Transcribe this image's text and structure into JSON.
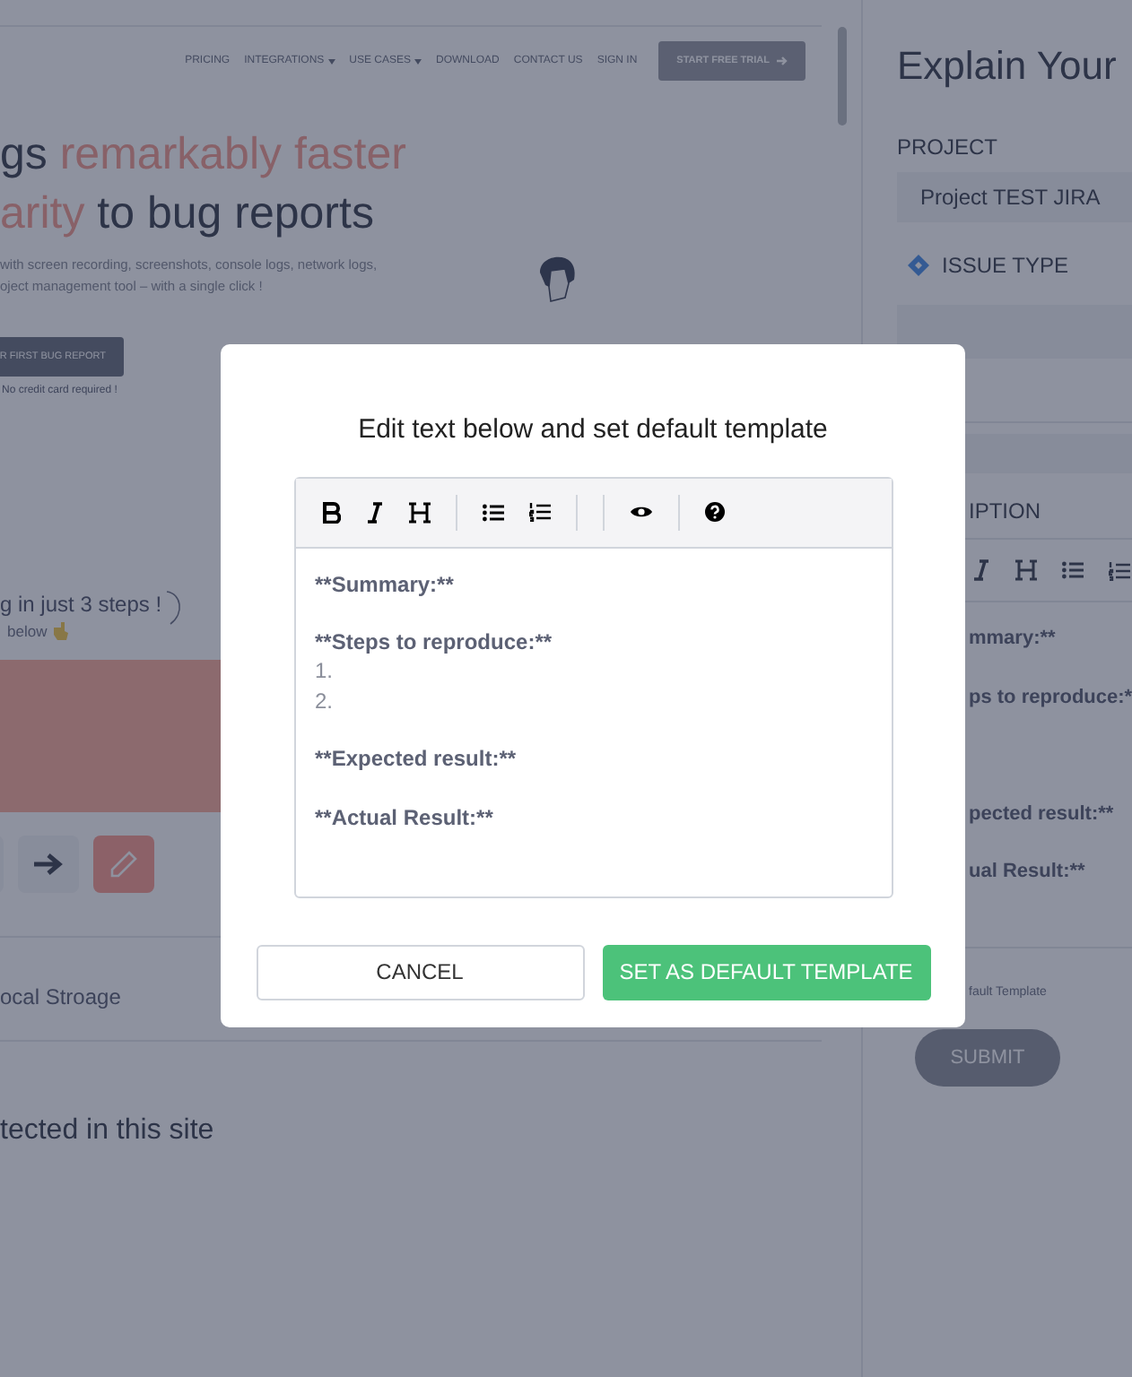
{
  "nav": {
    "items": [
      {
        "label": "PRICING",
        "dropdown": false
      },
      {
        "label": "INTEGRATIONS",
        "dropdown": true
      },
      {
        "label": "USE CASES",
        "dropdown": true
      },
      {
        "label": "DOWNLOAD",
        "dropdown": false
      },
      {
        "label": "CONTACT US",
        "dropdown": false
      },
      {
        "label": "SIGN IN",
        "dropdown": false
      }
    ],
    "cta": "START FREE TRIAL"
  },
  "hero": {
    "headline": [
      [
        {
          "text": "gs ",
          "accent": false
        },
        {
          "text": "remarkably faster",
          "accent": true
        }
      ],
      [
        {
          "text": "arity",
          "accent": true
        },
        {
          "text": " to bug reports",
          "accent": false
        }
      ]
    ],
    "subtitle": [
      "with screen recording, screenshots, console logs, network logs,",
      "oject management tool – with a single click !"
    ],
    "button": "R FIRST BUG REPORT",
    "note": "No credit card required !"
  },
  "steps": {
    "title": "g in just 3 steps !",
    "hint": "below"
  },
  "tools": [
    {
      "kind": "arrow",
      "selected": false
    },
    {
      "kind": "pencil",
      "selected": true
    }
  ],
  "storage": "ocal Stroage",
  "detected": "tected in this site",
  "panel": {
    "title": "Explain Your",
    "project_label": "PROJECT",
    "project_value": "Project TEST JIRA",
    "issue_label": "ISSUE TYPE",
    "description_label": "IPTION",
    "toolbar": [
      {
        "kind": "italic"
      },
      {
        "kind": "heading"
      },
      {
        "kind": "bullets"
      },
      {
        "kind": "numbers"
      }
    ],
    "lines": [
      "mmary:**",
      "ps to reproduce:*",
      "pected result:**",
      "ual Result:**"
    ],
    "template_note": "fault Template",
    "submit": "SUBMIT"
  },
  "modal": {
    "title": "Edit text below and set default template",
    "toolbar": [
      {
        "kind": "bold"
      },
      {
        "kind": "italic"
      },
      {
        "kind": "heading"
      },
      {
        "kind": "divider"
      },
      {
        "kind": "bullets"
      },
      {
        "kind": "numbers"
      },
      {
        "kind": "divider"
      },
      {
        "kind": "divider"
      },
      {
        "kind": "preview"
      },
      {
        "kind": "divider"
      },
      {
        "kind": "help"
      }
    ],
    "paragraphs": [
      [
        {
          "text": "**Summary:**",
          "kind": "heading"
        }
      ],
      [
        {
          "text": "**Steps to reproduce:**",
          "kind": "heading"
        },
        {
          "text": "1.",
          "kind": "item"
        },
        {
          "text": "2.",
          "kind": "item"
        }
      ],
      [
        {
          "text": "**Expected result:**",
          "kind": "heading"
        }
      ],
      [
        {
          "text": "**Actual Result:**",
          "kind": "heading"
        }
      ]
    ],
    "cancel": "CANCEL",
    "confirm": "SET AS DEFAULT TEMPLATE"
  }
}
